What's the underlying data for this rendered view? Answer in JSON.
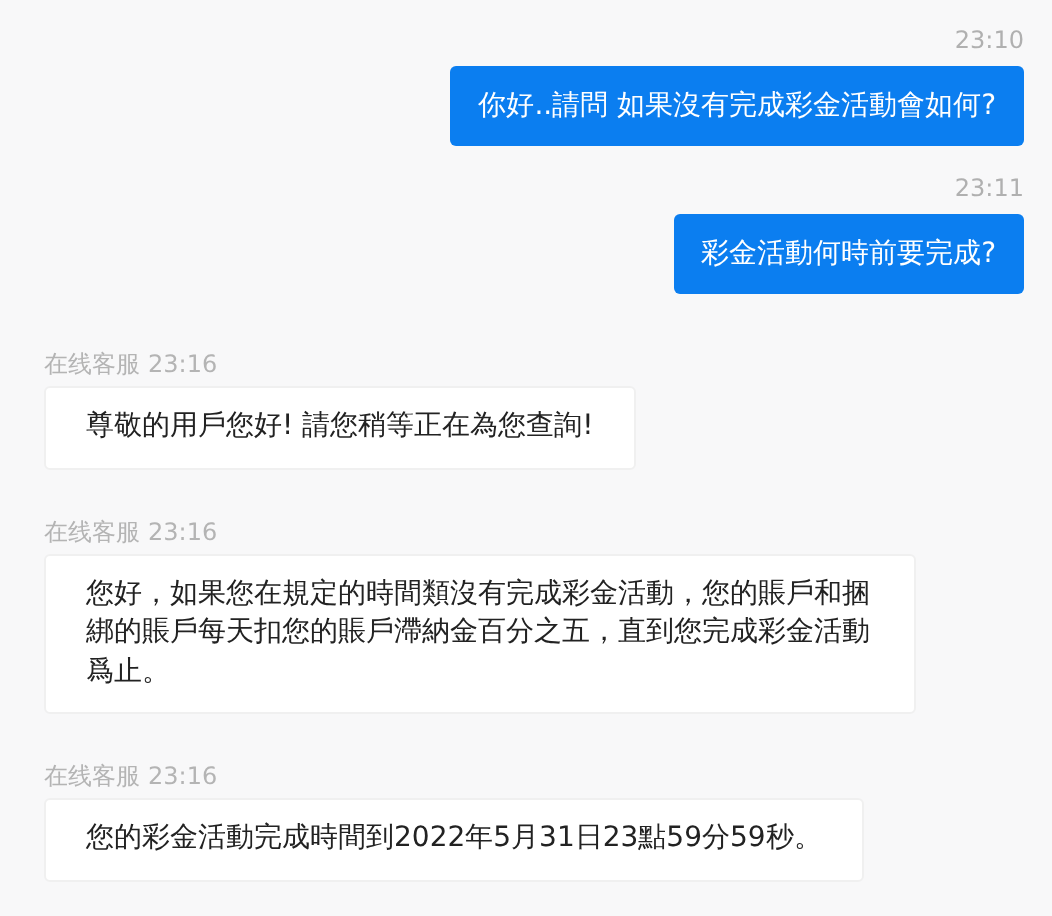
{
  "messages": [
    {
      "kind": "sent",
      "time": "23:10",
      "text": "你好..請問 如果沒有完成彩金活動會如何?"
    },
    {
      "kind": "sent",
      "time": "23:11",
      "text": "彩金活動何時前要完成?"
    },
    {
      "kind": "received",
      "sender": "在线客服",
      "time": "23:16",
      "text": "尊敬的用戶您好! 請您稍等正在為您查詢!"
    },
    {
      "kind": "received",
      "sender": "在线客服",
      "time": "23:16",
      "text": "您好，如果您在規定的時間類沒有完成彩金活動，您的賬戶和捆綁的賬戶每天扣您的賬戶滯納金百分之五，直到您完成彩金活動爲止。"
    },
    {
      "kind": "received",
      "sender": "在线客服",
      "time": "23:16",
      "text": "您的彩金活動完成時間到2022年5月31日23點59分59秒。"
    }
  ]
}
